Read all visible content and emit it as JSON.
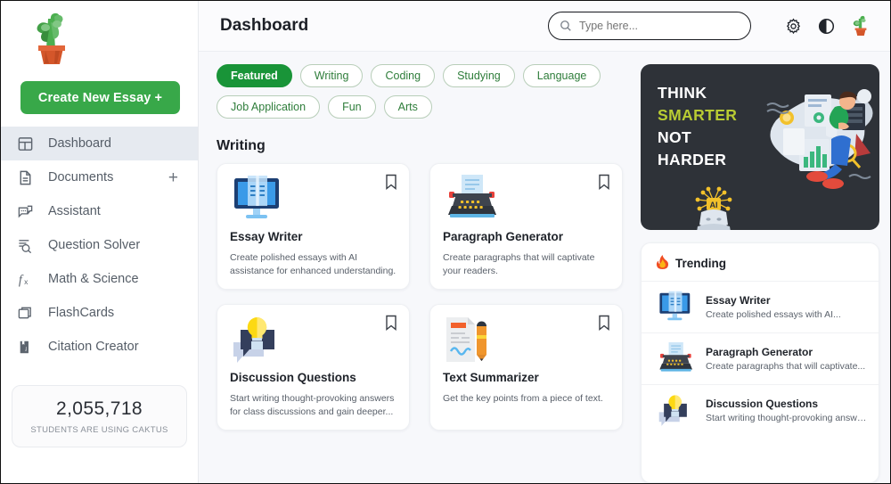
{
  "sidebar": {
    "logo_icon": "cactus-logo",
    "create_button": "Create New Essay +",
    "items": [
      {
        "label": "Dashboard",
        "icon": "dashboard-icon",
        "active": true,
        "has_plus": false
      },
      {
        "label": "Documents",
        "icon": "document-icon",
        "active": false,
        "has_plus": true
      },
      {
        "label": "Assistant",
        "icon": "chat-bubbles-icon",
        "active": false,
        "has_plus": false
      },
      {
        "label": "Question Solver",
        "icon": "search-lines-icon",
        "active": false,
        "has_plus": false
      },
      {
        "label": "Math & Science",
        "icon": "function-fx-icon",
        "active": false,
        "has_plus": false
      },
      {
        "label": "FlashCards",
        "icon": "cards-stack-icon",
        "active": false,
        "has_plus": false
      },
      {
        "label": "Citation Creator",
        "icon": "citation-book-icon",
        "active": false,
        "has_plus": false
      }
    ],
    "stats": {
      "number": "2,055,718",
      "caption": "STUDENTS ARE USING CAKTUS"
    }
  },
  "header": {
    "title": "Dashboard",
    "search": {
      "value": "",
      "placeholder": "Type here..."
    },
    "icons": [
      {
        "name": "settings-gear-icon"
      },
      {
        "name": "theme-contrast-icon"
      },
      {
        "name": "user-avatar-cactus"
      }
    ]
  },
  "filters": {
    "chips": [
      {
        "label": "Featured",
        "active": true
      },
      {
        "label": "Writing",
        "active": false
      },
      {
        "label": "Coding",
        "active": false
      },
      {
        "label": "Studying",
        "active": false
      },
      {
        "label": "Language",
        "active": false
      },
      {
        "label": "Job Application",
        "active": false
      },
      {
        "label": "Fun",
        "active": false
      },
      {
        "label": "Arts",
        "active": false
      }
    ]
  },
  "section": {
    "title": "Writing",
    "cards": [
      {
        "name": "Essay Writer",
        "desc": "Create polished essays with AI assistance for enhanced understanding.",
        "icon": "monitor-book-icon"
      },
      {
        "name": "Paragraph Generator",
        "desc": "Create paragraphs that will captivate your readers.",
        "icon": "typewriter-icon"
      },
      {
        "name": "Discussion Questions",
        "desc": "Start writing thought-provoking answers for class discussions and gain deeper...",
        "icon": "speech-bulb-icon"
      },
      {
        "name": "Text Summarizer",
        "desc": "Get the key points from a piece of text.",
        "icon": "document-pencil-icon"
      }
    ]
  },
  "banner": {
    "line1": "THINK",
    "line2": "SMARTER",
    "line3": "NOT",
    "line4": "HARDER",
    "highlight_color": "#b9cc33",
    "background_color": "#2e3238"
  },
  "trending": {
    "title": "Trending",
    "icon": "fire-icon",
    "items": [
      {
        "name": "Essay Writer",
        "desc": "Create polished essays with AI...",
        "icon": "monitor-book-icon"
      },
      {
        "name": "Paragraph Generator",
        "desc": "Create paragraphs that will captivate...",
        "icon": "typewriter-icon"
      },
      {
        "name": "Discussion Questions",
        "desc": "Start writing thought-provoking answers...",
        "icon": "speech-bulb-icon"
      }
    ]
  },
  "theme": {
    "accent_green": "#38a849",
    "chip_green": "#199438",
    "page_background": "#f7f8fb"
  }
}
